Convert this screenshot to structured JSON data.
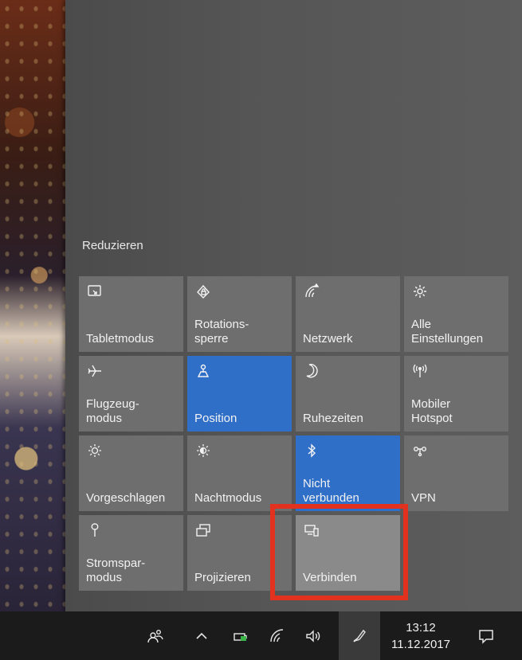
{
  "action_center": {
    "collapse_label": "Reduzieren",
    "tiles": [
      {
        "label": "Tabletmodus",
        "icon": "tablet-mode-icon",
        "state": "off"
      },
      {
        "label": "Rotations-\nsperre",
        "icon": "rotation-lock-icon",
        "state": "off"
      },
      {
        "label": "Netzwerk",
        "icon": "network-icon",
        "state": "off"
      },
      {
        "label": "Alle\nEinstellungen",
        "icon": "settings-gear-icon",
        "state": "off"
      },
      {
        "label": "Flugzeug-\nmodus",
        "icon": "airplane-icon",
        "state": "off"
      },
      {
        "label": "Position",
        "icon": "location-icon",
        "state": "on"
      },
      {
        "label": "Ruhezeiten",
        "icon": "moon-icon",
        "state": "off"
      },
      {
        "label": "Mobiler\nHotspot",
        "icon": "hotspot-icon",
        "state": "off"
      },
      {
        "label": "Vorgeschlagen",
        "icon": "brightness-icon",
        "state": "off"
      },
      {
        "label": "Nachtmodus",
        "icon": "night-light-icon",
        "state": "off"
      },
      {
        "label": "Nicht\nverbunden",
        "icon": "bluetooth-icon",
        "state": "on"
      },
      {
        "label": "VPN",
        "icon": "vpn-icon",
        "state": "off"
      },
      {
        "label": "Stromspar-\nmodus",
        "icon": "battery-saver-icon",
        "state": "off"
      },
      {
        "label": "Projizieren",
        "icon": "project-icon",
        "state": "off"
      },
      {
        "label": "Verbinden",
        "icon": "connect-icon",
        "state": "highlighted"
      }
    ]
  },
  "taskbar": {
    "time": "13:12",
    "date": "11.12.2017",
    "icons": [
      "people-icon",
      "chevron-up-icon",
      "battery-icon",
      "wifi-icon",
      "volume-icon",
      "pen-workspace-icon",
      "notification-icon"
    ]
  },
  "colors": {
    "active_tile": "#2f6fc8",
    "tile": "#6e6e6e",
    "annotation": "#e2321f"
  }
}
